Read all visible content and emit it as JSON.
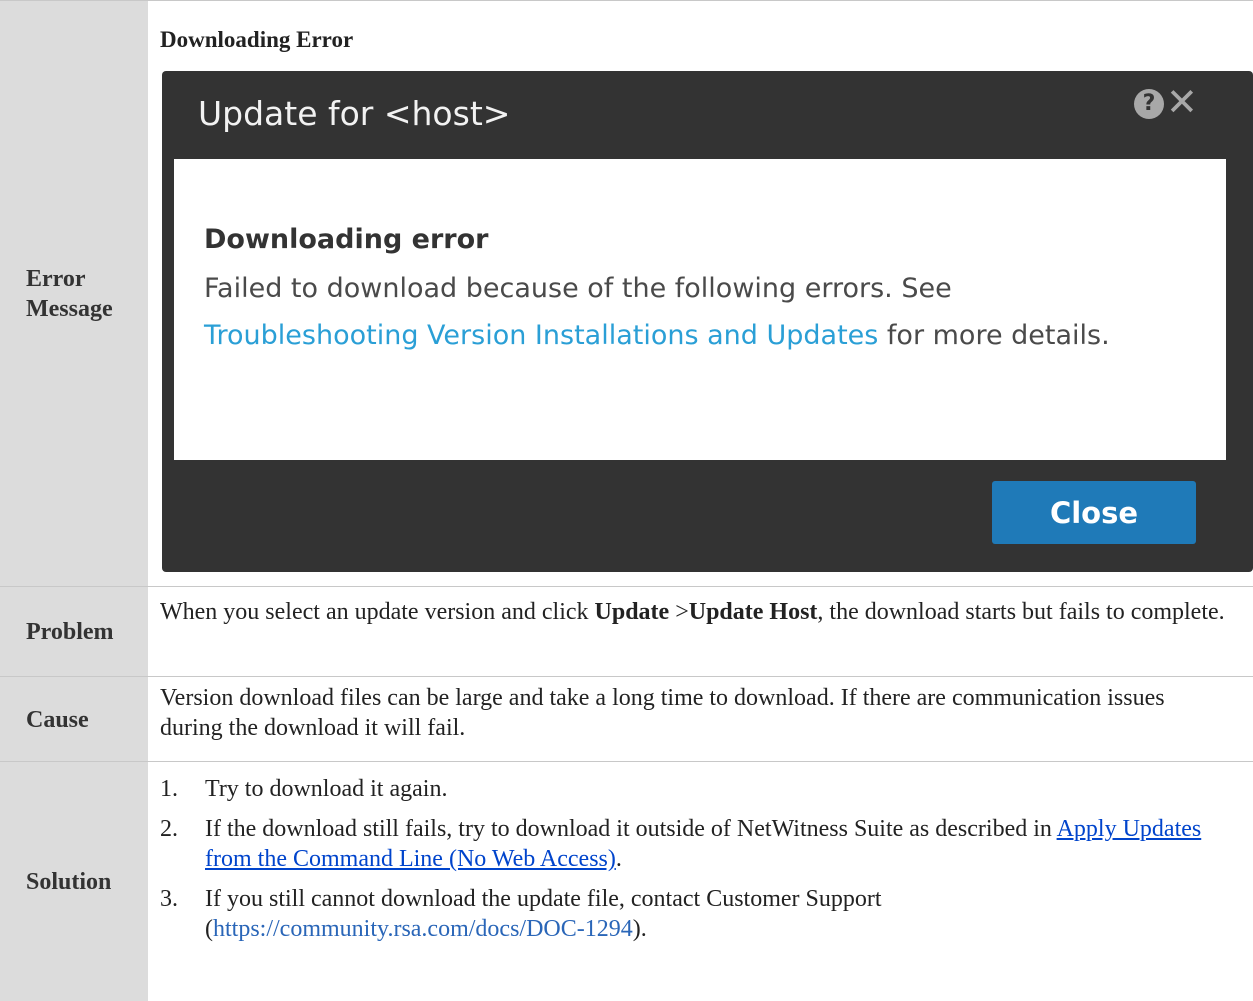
{
  "rows": {
    "error_message": {
      "label": "Error Message",
      "heading": "Downloading Error",
      "dialog": {
        "title": "Update for <host>",
        "help_glyph": "?",
        "close_glyph": "✕",
        "body_title": "Downloading error",
        "body_text_1": "Failed to download because of the following errors. See",
        "body_link": "Troubleshooting Version Installations and Updates",
        "body_text_2": " for more details.",
        "button": "Close"
      }
    },
    "problem": {
      "label": "Problem",
      "text_1": "When you select an update version and click ",
      "bold_1": "Update",
      "text_2": " >",
      "bold_2": "Update Host",
      "text_3": ", the download starts but fails to complete."
    },
    "cause": {
      "label": "Cause",
      "text": "Version download files can be large and take a long time to download. If there are communication issues during the download it will fail."
    },
    "solution": {
      "label": "Solution",
      "steps": [
        {
          "num": "1.",
          "text": "Try to download it again."
        },
        {
          "num": "2.",
          "text": "If the download still fails, try to download it outside of NetWitness Suite as described in ",
          "link": "Apply Updates from the Command Line (No Web Access)",
          "after": "."
        },
        {
          "num": "3.",
          "text": "If you still cannot download the update file, contact Customer Support (",
          "link": "https://community.rsa.com/docs/DOC-1294",
          "after": ")."
        }
      ]
    }
  },
  "colors": {
    "label_bg": "#dcdcdc",
    "dialog_bg": "#333333",
    "button_bg": "#1f7ab8",
    "dialog_link": "#2a9fd6",
    "doc_link": "#0044cc"
  }
}
